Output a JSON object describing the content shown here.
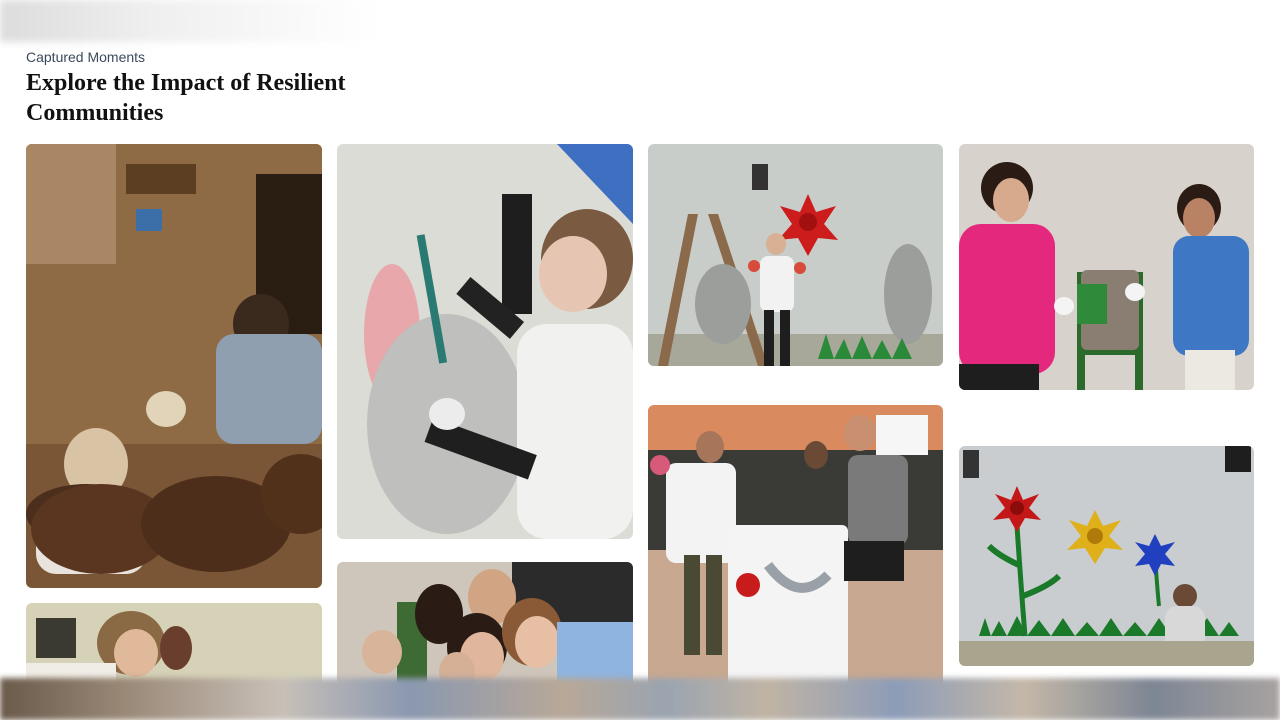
{
  "header": {
    "eyebrow": "Captured Moments",
    "title": "Explore the Impact of Resilient Communities"
  },
  "gallery": {
    "photos": [
      {
        "subject": "pottery-workshop"
      },
      {
        "subject": "person-painting-mural"
      },
      {
        "subject": "volunteer-waving-by-mural"
      },
      {
        "subject": "volunteers-painting-bin-stand"
      },
      {
        "subject": "group-near-wall"
      },
      {
        "subject": "group-selfie"
      },
      {
        "subject": "volunteers-painting-trash-bin"
      },
      {
        "subject": "flower-mural-painting"
      }
    ]
  }
}
